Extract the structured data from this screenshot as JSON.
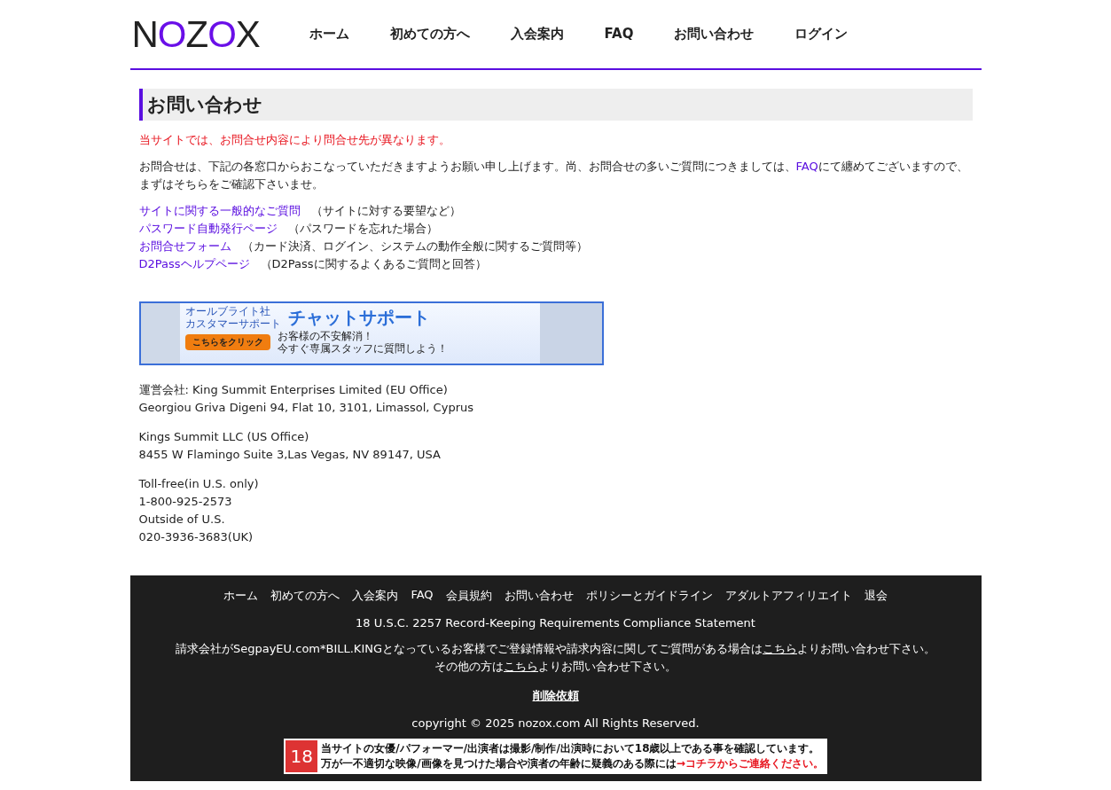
{
  "logo": [
    {
      "text": "N",
      "accent": false
    },
    {
      "text": "O",
      "accent": true
    },
    {
      "text": "Z",
      "accent": false
    },
    {
      "text": "O",
      "accent": true
    },
    {
      "text": "X",
      "accent": false
    }
  ],
  "nav": [
    "ホーム",
    "初めての方へ",
    "入会案内",
    "FAQ",
    "お問い合わせ",
    "ログイン"
  ],
  "page_title": "お問い合わせ",
  "notice": "当サイトでは、お問合せ内容により問合せ先が異なります。",
  "intro": {
    "before": "お問合せは、下記の各窓口からおこなっていただきますようお願い申し上げます。尚、お問合せの多いご質問につきましては、",
    "link": "FAQ",
    "after": "にて纏めてございますので、まずはそちらをご確認下さいませ。"
  },
  "contact_links": [
    {
      "link": "サイトに関する一般的なご質問",
      "note": "（サイトに対する要望など）"
    },
    {
      "link": "パスワード自動発行ページ",
      "note": "（パスワードを忘れた場合）"
    },
    {
      "link": "お問合せフォーム",
      "note": "（カード決済、ログイン、システムの動作全般に関するご質問等）"
    },
    {
      "link": "D2Passヘルプページ",
      "note": "（D2Passに関するよくあるご質問と回答）"
    }
  ],
  "banner": {
    "company": [
      "オールブライト社",
      "カスタマーサポート"
    ],
    "headline": "チャットサポート",
    "button": "こちらをクリック",
    "message": [
      "お客様の不安解消！",
      "今すぐ専属スタッフに質問しよう！"
    ]
  },
  "addresses": [
    [
      "運営会社: King Summit Enterprises Limited (EU Office)",
      "Georgiou Griva Digeni 94, Flat 10, 3101, Limassol, Cyprus"
    ],
    [
      "Kings Summit LLC (US Office)",
      "8455 W Flamingo Suite 3,Las Vegas, NV 89147, USA"
    ],
    [
      "Toll-free(in U.S. only)",
      "1-800-925-2573",
      "Outside of U.S.",
      "020-3936-3683(UK)"
    ]
  ],
  "footer": {
    "nav": [
      "ホーム",
      "初めての方へ",
      "入会案内",
      "FAQ",
      "会員規約",
      "お問い合わせ",
      "ポリシーとガイドライン",
      "アダルトアフィリエイト",
      "退会"
    ],
    "compliance": "18 U.S.C. 2257 Record-Keeping Requirements Compliance Statement",
    "billing": {
      "before": "請求会社がSegpayEU.com*BILL.KINGとなっているお客様でご登録情報や請求内容に関してご質問がある場合は",
      "link": "こちら",
      "after": "よりお問い合わせ下さい。"
    },
    "other": {
      "before": "その他の方は",
      "link": "こちら",
      "after": "よりお問い合わせ下さい。"
    },
    "removal": "削除依頼",
    "copyright": "copyright © 2025 nozox.com All Rights Reserved.",
    "age_badge": {
      "icon": "18",
      "line1": "当サイトの女優/パフォーマー/出演者は撮影/制作/出演時において18歳以上である事を確認しています。",
      "line2": "万が一不適切な映像/画像を見つけた場合や演者の年齢に疑義のある際には",
      "link": "→コチラからご連絡ください。"
    }
  }
}
